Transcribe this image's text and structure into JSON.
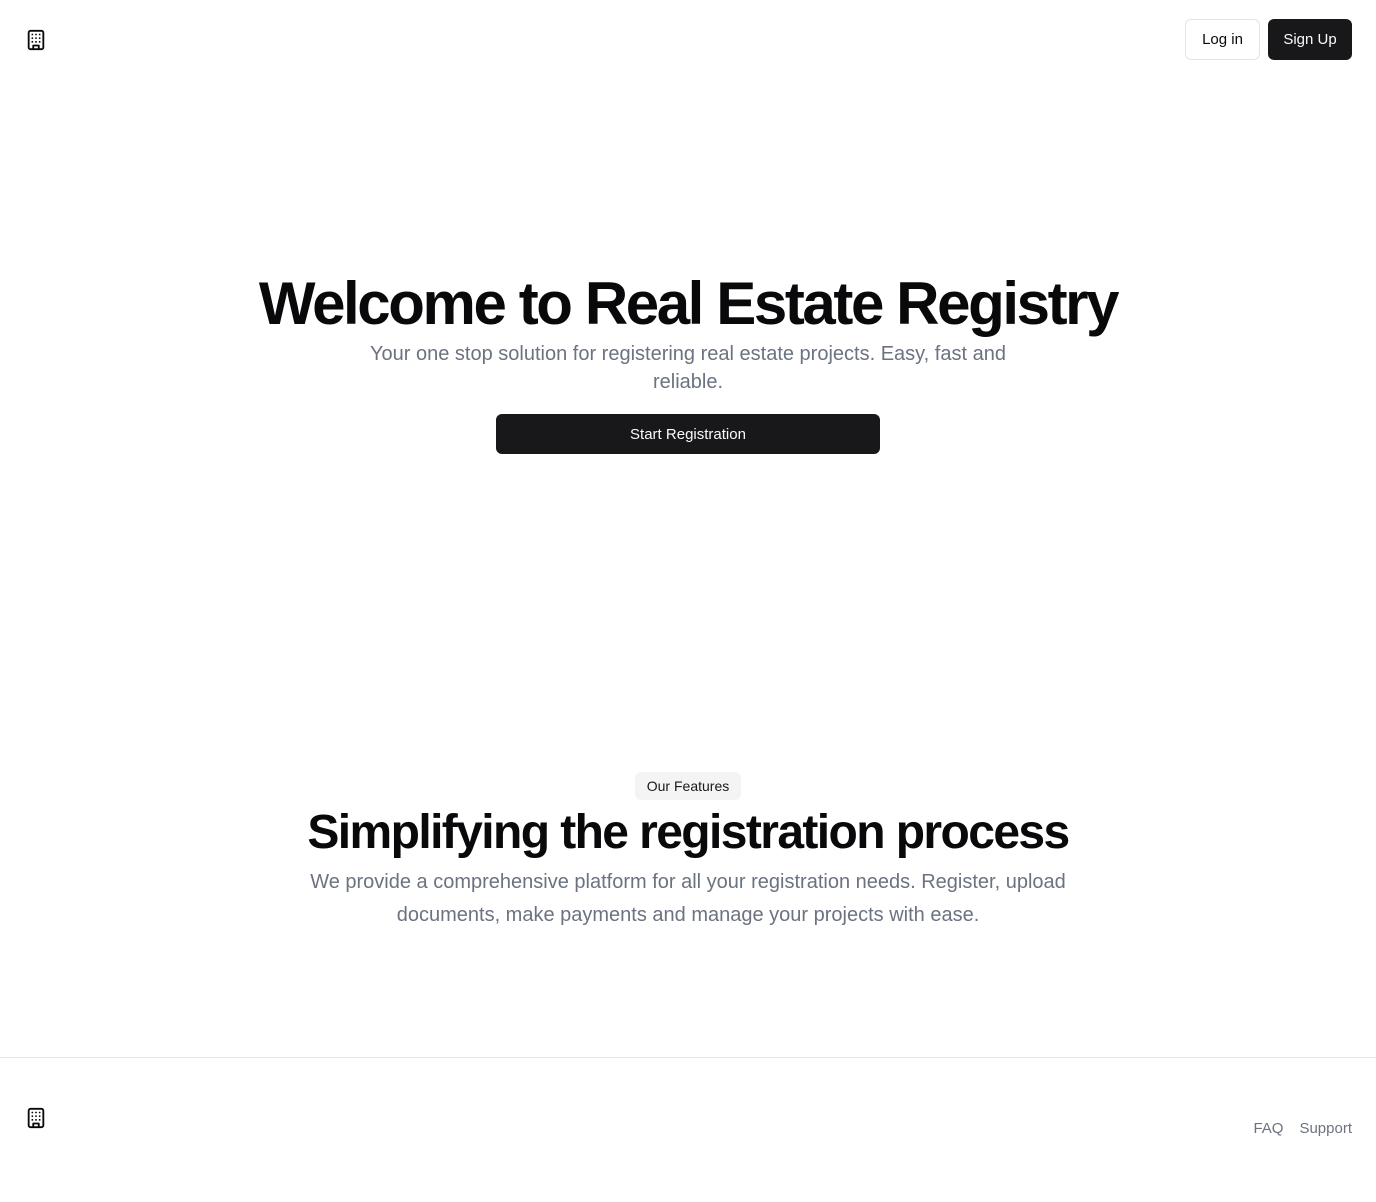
{
  "header": {
    "logo_icon": "building-icon",
    "login_label": "Log in",
    "signup_label": "Sign Up"
  },
  "hero": {
    "title": "Welcome to Real Estate Registry",
    "subtitle": "Your one stop solution for registering real estate projects. Easy, fast and reliable.",
    "cta_label": "Start Registration"
  },
  "features": {
    "badge": "Our Features",
    "title": "Simplifying the registration process",
    "description": "We provide a comprehensive platform for all your registration needs. Register, upload documents, make payments and manage your projects with ease."
  },
  "footer": {
    "logo_icon": "building-icon",
    "links": [
      "FAQ",
      "Support"
    ]
  },
  "colors": {
    "primary": "#18181b",
    "muted_text": "#6b7280",
    "badge_bg": "#f4f4f5",
    "border": "#e4e4e7"
  }
}
